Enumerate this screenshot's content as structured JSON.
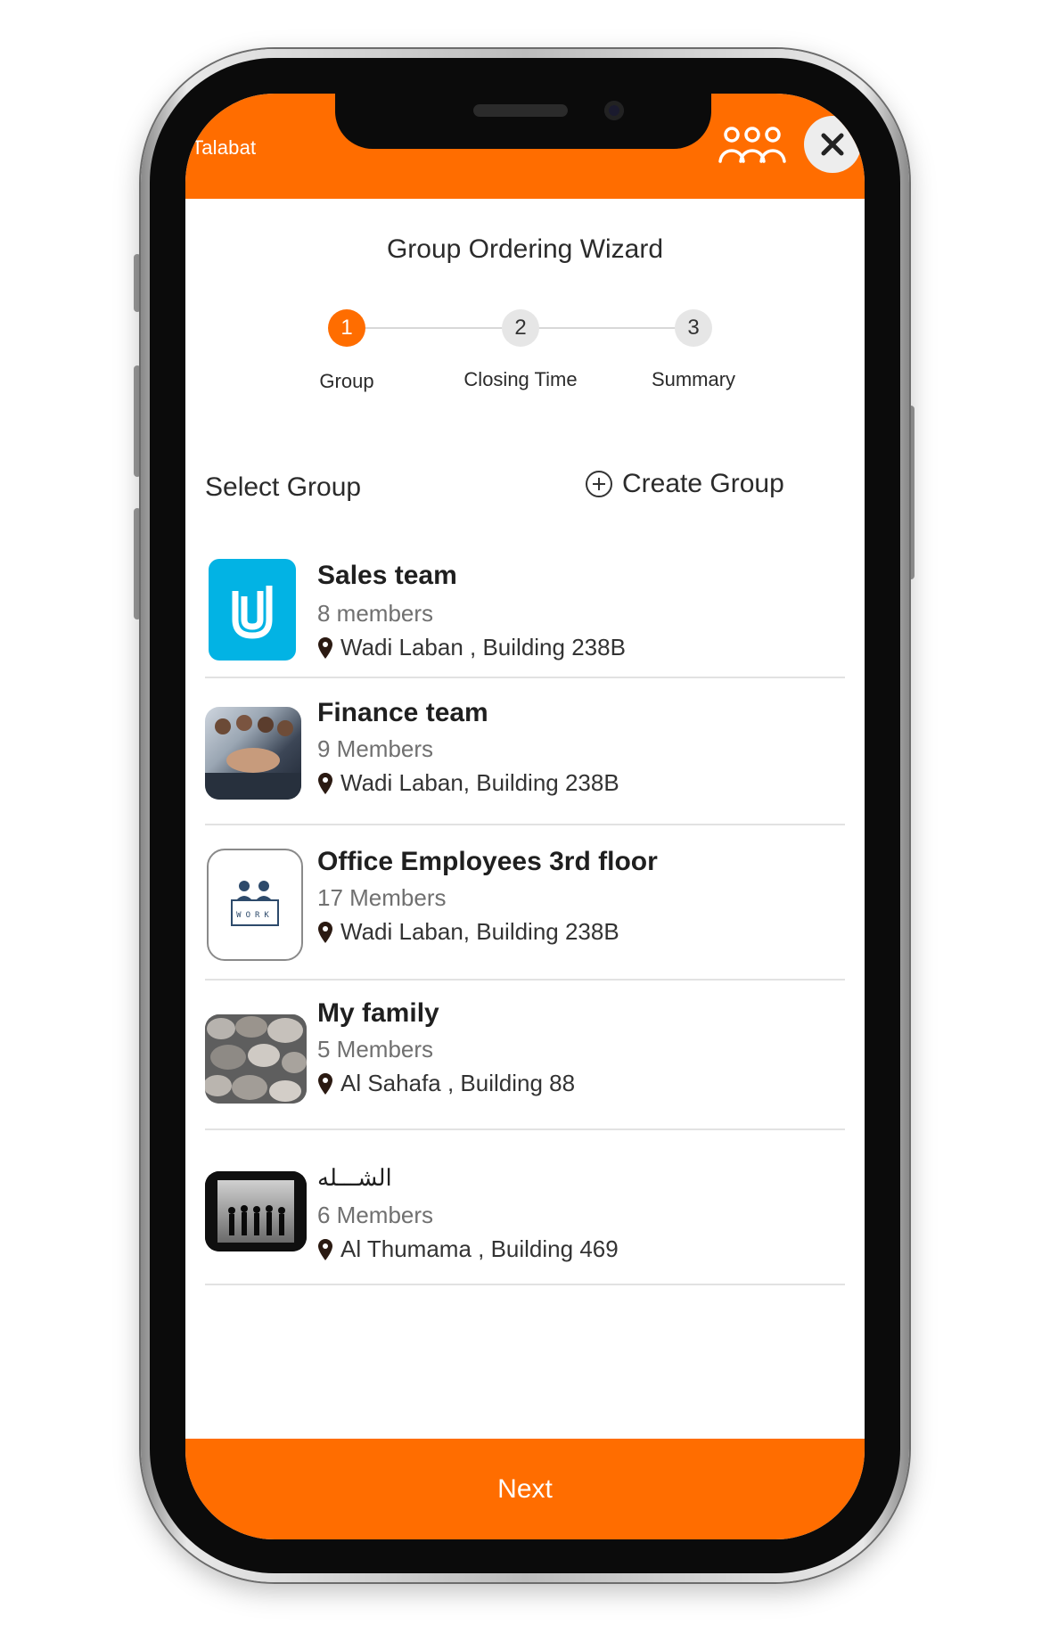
{
  "app": {
    "brand": "Talabat"
  },
  "wizard": {
    "title": "Group Ordering Wizard",
    "steps": [
      {
        "number": "1",
        "label": "Group",
        "active": true
      },
      {
        "number": "2",
        "label": "Closing Time",
        "active": false
      },
      {
        "number": "3",
        "label": "Summary",
        "active": false
      }
    ]
  },
  "groups_section": {
    "title": "Select Group",
    "create_label": "Create Group"
  },
  "groups": [
    {
      "name": "Sales team",
      "members": "8 members",
      "location": "Wadi Laban , Building 238B"
    },
    {
      "name": "Finance team",
      "members": "9 Members",
      "location": "Wadi Laban, Building 238B"
    },
    {
      "name": "Office Employees 3rd floor",
      "members": "17 Members",
      "location": "Wadi Laban, Building 238B"
    },
    {
      "name": "My family",
      "members": "5 Members",
      "location": "Al Sahafa , Building 88"
    },
    {
      "name": "الشـــله",
      "members": "6 Members",
      "location": "Al Thumama , Building 469"
    }
  ],
  "work_logo_text": "WORK",
  "footer": {
    "next_label": "Next"
  },
  "colors": {
    "accent": "#ff6d00",
    "sales_logo_bg": "#02b3e4"
  },
  "icons": {
    "group": "group-people-icon",
    "close": "close-icon",
    "plus": "plus-circle-icon",
    "pin": "location-pin-icon"
  }
}
